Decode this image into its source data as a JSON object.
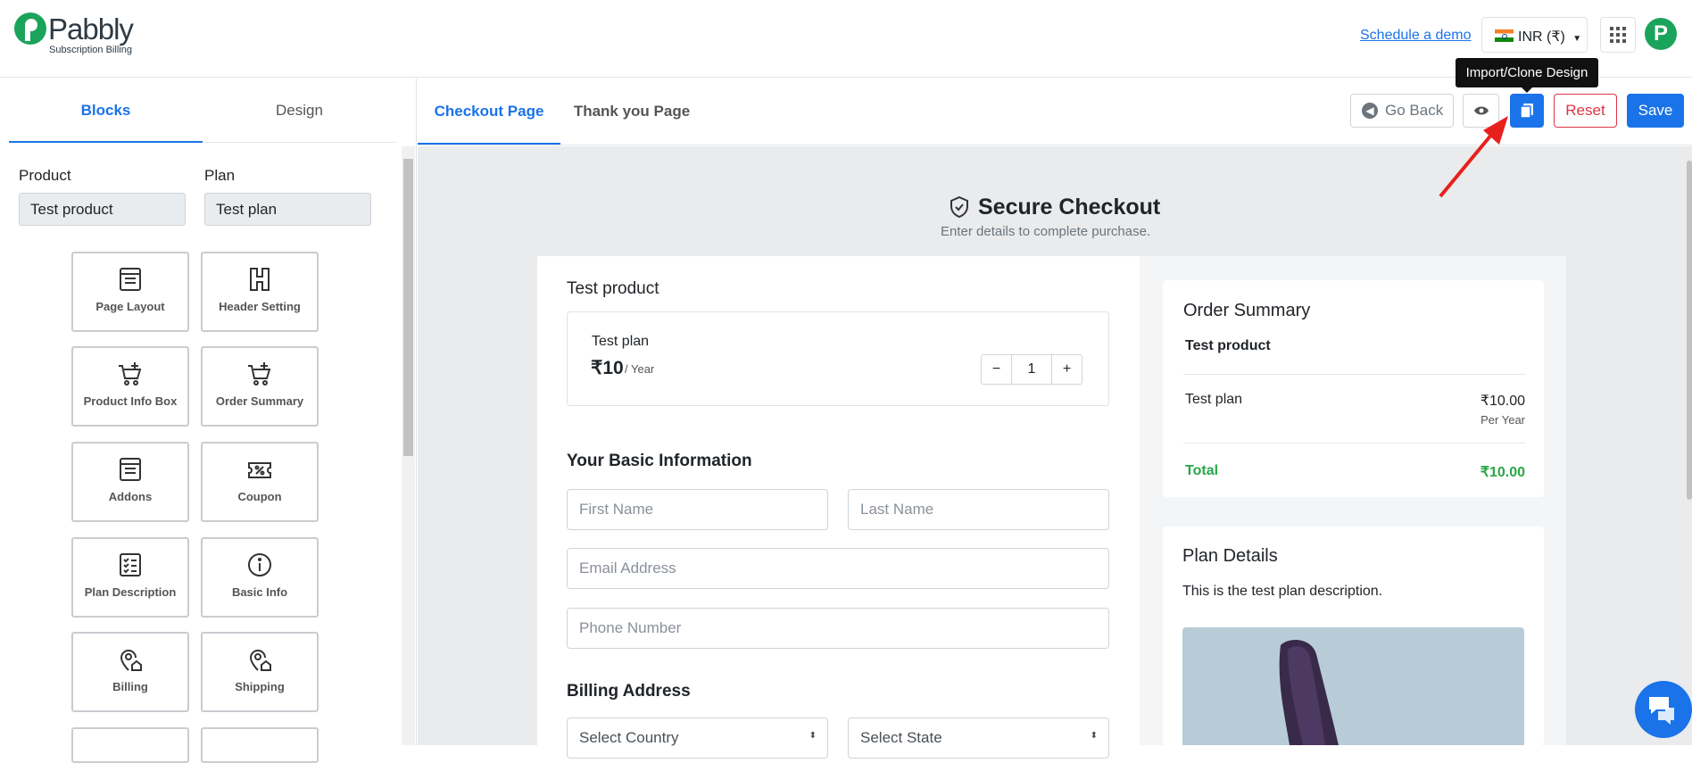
{
  "header": {
    "logo_name": "Pabbly",
    "logo_sub": "Subscription Billing",
    "schedule_demo": "Schedule a demo",
    "currency": "INR (₹)",
    "avatar_letter": "P"
  },
  "left_panel": {
    "tabs": [
      "Blocks",
      "Design"
    ],
    "product_label": "Product",
    "plan_label": "Plan",
    "product_value": "Test product",
    "plan_value": "Test plan",
    "blocks": [
      "Page Layout",
      "Header Setting",
      "Product Info Box",
      "Order Summary",
      "Addons",
      "Coupon",
      "Plan Description",
      "Basic Info",
      "Billing",
      "Shipping"
    ]
  },
  "editor_header": {
    "tabs": [
      "Checkout Page",
      "Thank you Page"
    ],
    "go_back": "Go Back",
    "reset": "Reset",
    "save": "Save",
    "tooltip": "Import/Clone Design"
  },
  "checkout": {
    "title": "Secure Checkout",
    "subtitle": "Enter details to complete purchase.",
    "product_name": "Test product",
    "plan_name": "Test plan",
    "price": "₹10",
    "period": "/ Year",
    "quantity": "1",
    "basic_info_heading": "Your Basic Information",
    "first_name_placeholder": "First Name",
    "last_name_placeholder": "Last Name",
    "email_placeholder": "Email Address",
    "phone_placeholder": "Phone Number",
    "billing_heading": "Billing Address",
    "country_placeholder": "Select Country",
    "state_placeholder": "Select State"
  },
  "order_summary": {
    "heading": "Order Summary",
    "product": "Test product",
    "plan": "Test plan",
    "plan_price": "₹10.00",
    "plan_period": "Per Year",
    "total_label": "Total",
    "total_value": "₹10.00"
  },
  "plan_details": {
    "heading": "Plan Details",
    "description": "This is the test plan description."
  },
  "colors": {
    "primary": "#1a73e8",
    "danger": "#dc3545",
    "success": "#28a745",
    "brand": "#1aa35a"
  }
}
